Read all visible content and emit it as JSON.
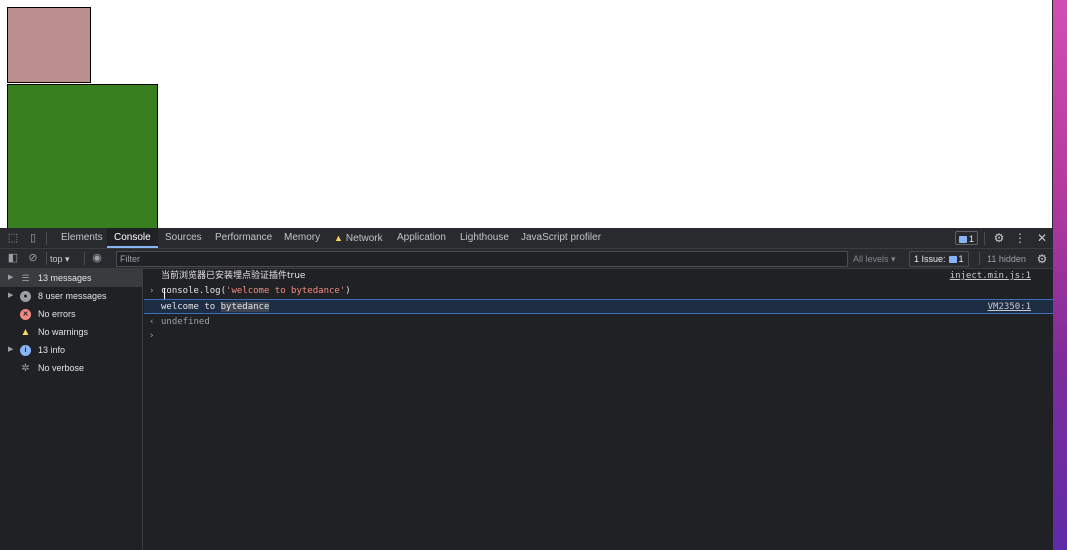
{
  "tabbar": {
    "tabs": [
      {
        "label": "Elements"
      },
      {
        "label": "Console"
      },
      {
        "label": "Sources"
      },
      {
        "label": "Performance"
      },
      {
        "label": "Memory"
      },
      {
        "label": "Network"
      },
      {
        "label": "Application"
      },
      {
        "label": "Lighthouse"
      },
      {
        "label": "JavaScript profiler"
      }
    ],
    "active_tab": "Console",
    "message_count": "1"
  },
  "toolbar": {
    "context": "top",
    "filter_placeholder": "Filter",
    "levels": "All levels",
    "issues_label": "1 Issue:",
    "issues_count": "1",
    "hidden": "11 hidden"
  },
  "sidebar": {
    "items": [
      {
        "label": "13 messages",
        "icon": "list-icon"
      },
      {
        "label": "8 user messages",
        "icon": "user-icon"
      },
      {
        "label": "No errors",
        "icon": "error-icon"
      },
      {
        "label": "No warnings",
        "icon": "warning-icon"
      },
      {
        "label": "13 info",
        "icon": "info-icon"
      },
      {
        "label": "No verbose",
        "icon": "verbose-icon"
      }
    ]
  },
  "console": {
    "lines": [
      {
        "text": "当前浏览器已安装埋点验证插件true",
        "source": "inject.min.js:1"
      },
      {
        "code_prefix": "console.log(",
        "code_string": "'welcome to bytedance'",
        "code_suffix": ")"
      },
      {
        "text_prefix": "welcome to ",
        "text_selected": "bytedance",
        "source": "VM2350:1"
      },
      {
        "text": "undefined"
      }
    ]
  },
  "colors": {
    "devtools_bg": "#202124",
    "accent": "#8ab4f8",
    "pink_box": "#bc8f8f",
    "green_box": "#38801f"
  }
}
